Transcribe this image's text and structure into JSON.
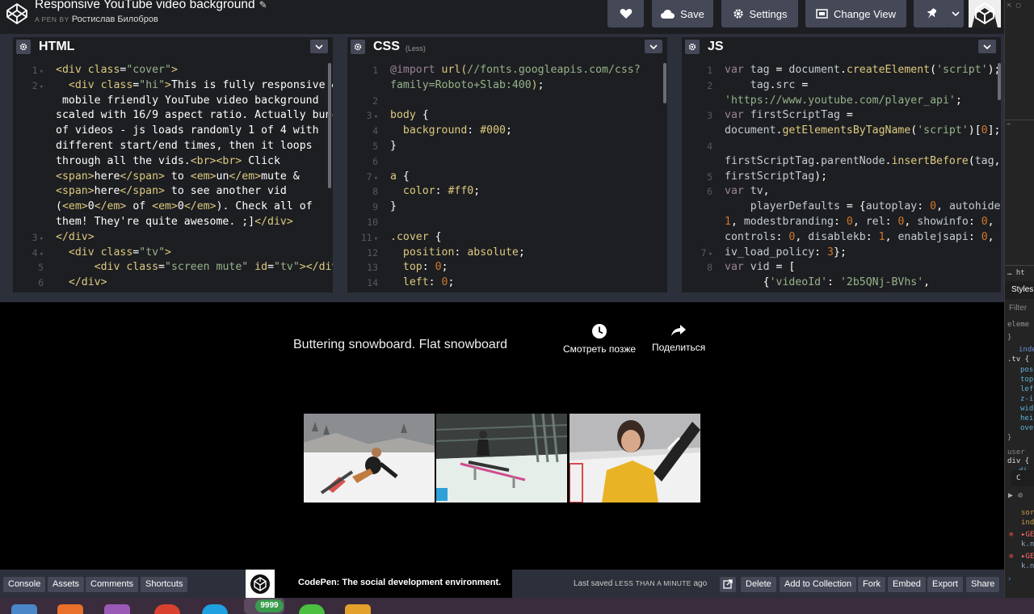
{
  "header": {
    "pen_title": "Responsive YouTube video background",
    "author_prefix": "A PEN BY",
    "author_name": "Ростислав Билобров",
    "buttons": {
      "save": "Save",
      "settings": "Settings",
      "change_view": "Change View"
    }
  },
  "editors": {
    "html": {
      "name": "HTML",
      "lines": [
        {
          "n": "1",
          "fold": true
        },
        {
          "n": "2",
          "fold": true
        },
        {
          "n": "",
          "fold": false
        },
        {
          "n": "",
          "fold": false
        },
        {
          "n": "",
          "fold": false
        },
        {
          "n": "",
          "fold": false
        },
        {
          "n": "",
          "fold": false
        },
        {
          "n": "",
          "fold": false
        },
        {
          "n": "",
          "fold": false
        },
        {
          "n": "",
          "fold": false
        },
        {
          "n": "",
          "fold": false
        },
        {
          "n": "3",
          "fold": true
        },
        {
          "n": "4",
          "fold": true
        },
        {
          "n": "5",
          "fold": false
        },
        {
          "n": "6",
          "fold": false
        }
      ]
    },
    "css": {
      "name": "CSS",
      "sub": "(Less)",
      "lines": [
        {
          "n": "1",
          "fold": false
        },
        {
          "n": "",
          "fold": false
        },
        {
          "n": "2",
          "fold": false
        },
        {
          "n": "3",
          "fold": true
        },
        {
          "n": "4",
          "fold": false
        },
        {
          "n": "5",
          "fold": false
        },
        {
          "n": "6",
          "fold": false
        },
        {
          "n": "7",
          "fold": true
        },
        {
          "n": "8",
          "fold": false
        },
        {
          "n": "9",
          "fold": false
        },
        {
          "n": "10",
          "fold": false
        },
        {
          "n": "11",
          "fold": true
        },
        {
          "n": "12",
          "fold": false
        },
        {
          "n": "13",
          "fold": false
        },
        {
          "n": "14",
          "fold": false
        }
      ]
    },
    "js": {
      "name": "JS",
      "lines": [
        {
          "n": "1",
          "fold": false
        },
        {
          "n": "2",
          "fold": false
        },
        {
          "n": "",
          "fold": false
        },
        {
          "n": "3",
          "fold": false
        },
        {
          "n": "",
          "fold": false
        },
        {
          "n": "4",
          "fold": false
        },
        {
          "n": "",
          "fold": false
        },
        {
          "n": "5",
          "fold": false
        },
        {
          "n": "6",
          "fold": false
        },
        {
          "n": "",
          "fold": false
        },
        {
          "n": "",
          "fold": false
        },
        {
          "n": "",
          "fold": false
        },
        {
          "n": "7",
          "fold": true
        },
        {
          "n": "8",
          "fold": false
        },
        {
          "n": "",
          "fold": false
        }
      ]
    }
  },
  "preview": {
    "video_title": "Buttering snowboard. Flat snowboard",
    "watch_later": "Смотреть позже",
    "share": "Поделиться",
    "thumbnails": [
      "snowboard-butter",
      "snowboard-rail",
      "snowboard-interview"
    ]
  },
  "footer": {
    "buttons": [
      "Console",
      "Assets",
      "Comments",
      "Shortcuts"
    ],
    "promo": "CodePen: The social development environment.",
    "saved_prefix": "Last saved",
    "saved_when": "LESS THAN A MINUTE",
    "saved_suffix": "ago",
    "actions": [
      "Delete",
      "Add to Collection",
      "Fork",
      "Embed",
      "Export",
      "Share"
    ]
  },
  "devtools": {
    "styles_tab": "Styles",
    "filter": "Filter",
    "lines": [
      "eleme",
      "}",
      "inde",
      ".tv {",
      "pos",
      "top",
      "lef",
      "z-i",
      "wid",
      "hei",
      "ove",
      "}",
      "user",
      "div {",
      "di"
    ],
    "console_lines": [
      "sor",
      "ind",
      "▸GE",
      "k.n",
      "▸GE",
      "k.n"
    ]
  },
  "taskbar": {
    "badge": "9999"
  }
}
